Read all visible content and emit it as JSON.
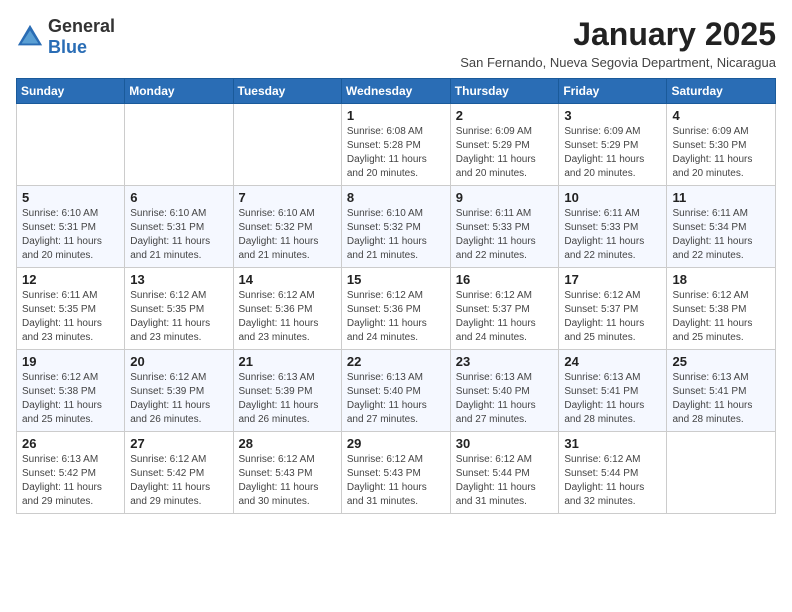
{
  "logo": {
    "general": "General",
    "blue": "Blue"
  },
  "title": "January 2025",
  "subtitle": "San Fernando, Nueva Segovia Department, Nicaragua",
  "weekdays": [
    "Sunday",
    "Monday",
    "Tuesday",
    "Wednesday",
    "Thursday",
    "Friday",
    "Saturday"
  ],
  "weeks": [
    [
      {
        "day": "",
        "info": ""
      },
      {
        "day": "",
        "info": ""
      },
      {
        "day": "",
        "info": ""
      },
      {
        "day": "1",
        "info": "Sunrise: 6:08 AM\nSunset: 5:28 PM\nDaylight: 11 hours and 20 minutes."
      },
      {
        "day": "2",
        "info": "Sunrise: 6:09 AM\nSunset: 5:29 PM\nDaylight: 11 hours and 20 minutes."
      },
      {
        "day": "3",
        "info": "Sunrise: 6:09 AM\nSunset: 5:29 PM\nDaylight: 11 hours and 20 minutes."
      },
      {
        "day": "4",
        "info": "Sunrise: 6:09 AM\nSunset: 5:30 PM\nDaylight: 11 hours and 20 minutes."
      }
    ],
    [
      {
        "day": "5",
        "info": "Sunrise: 6:10 AM\nSunset: 5:31 PM\nDaylight: 11 hours and 20 minutes."
      },
      {
        "day": "6",
        "info": "Sunrise: 6:10 AM\nSunset: 5:31 PM\nDaylight: 11 hours and 21 minutes."
      },
      {
        "day": "7",
        "info": "Sunrise: 6:10 AM\nSunset: 5:32 PM\nDaylight: 11 hours and 21 minutes."
      },
      {
        "day": "8",
        "info": "Sunrise: 6:10 AM\nSunset: 5:32 PM\nDaylight: 11 hours and 21 minutes."
      },
      {
        "day": "9",
        "info": "Sunrise: 6:11 AM\nSunset: 5:33 PM\nDaylight: 11 hours and 22 minutes."
      },
      {
        "day": "10",
        "info": "Sunrise: 6:11 AM\nSunset: 5:33 PM\nDaylight: 11 hours and 22 minutes."
      },
      {
        "day": "11",
        "info": "Sunrise: 6:11 AM\nSunset: 5:34 PM\nDaylight: 11 hours and 22 minutes."
      }
    ],
    [
      {
        "day": "12",
        "info": "Sunrise: 6:11 AM\nSunset: 5:35 PM\nDaylight: 11 hours and 23 minutes."
      },
      {
        "day": "13",
        "info": "Sunrise: 6:12 AM\nSunset: 5:35 PM\nDaylight: 11 hours and 23 minutes."
      },
      {
        "day": "14",
        "info": "Sunrise: 6:12 AM\nSunset: 5:36 PM\nDaylight: 11 hours and 23 minutes."
      },
      {
        "day": "15",
        "info": "Sunrise: 6:12 AM\nSunset: 5:36 PM\nDaylight: 11 hours and 24 minutes."
      },
      {
        "day": "16",
        "info": "Sunrise: 6:12 AM\nSunset: 5:37 PM\nDaylight: 11 hours and 24 minutes."
      },
      {
        "day": "17",
        "info": "Sunrise: 6:12 AM\nSunset: 5:37 PM\nDaylight: 11 hours and 25 minutes."
      },
      {
        "day": "18",
        "info": "Sunrise: 6:12 AM\nSunset: 5:38 PM\nDaylight: 11 hours and 25 minutes."
      }
    ],
    [
      {
        "day": "19",
        "info": "Sunrise: 6:12 AM\nSunset: 5:38 PM\nDaylight: 11 hours and 25 minutes."
      },
      {
        "day": "20",
        "info": "Sunrise: 6:12 AM\nSunset: 5:39 PM\nDaylight: 11 hours and 26 minutes."
      },
      {
        "day": "21",
        "info": "Sunrise: 6:13 AM\nSunset: 5:39 PM\nDaylight: 11 hours and 26 minutes."
      },
      {
        "day": "22",
        "info": "Sunrise: 6:13 AM\nSunset: 5:40 PM\nDaylight: 11 hours and 27 minutes."
      },
      {
        "day": "23",
        "info": "Sunrise: 6:13 AM\nSunset: 5:40 PM\nDaylight: 11 hours and 27 minutes."
      },
      {
        "day": "24",
        "info": "Sunrise: 6:13 AM\nSunset: 5:41 PM\nDaylight: 11 hours and 28 minutes."
      },
      {
        "day": "25",
        "info": "Sunrise: 6:13 AM\nSunset: 5:41 PM\nDaylight: 11 hours and 28 minutes."
      }
    ],
    [
      {
        "day": "26",
        "info": "Sunrise: 6:13 AM\nSunset: 5:42 PM\nDaylight: 11 hours and 29 minutes."
      },
      {
        "day": "27",
        "info": "Sunrise: 6:12 AM\nSunset: 5:42 PM\nDaylight: 11 hours and 29 minutes."
      },
      {
        "day": "28",
        "info": "Sunrise: 6:12 AM\nSunset: 5:43 PM\nDaylight: 11 hours and 30 minutes."
      },
      {
        "day": "29",
        "info": "Sunrise: 6:12 AM\nSunset: 5:43 PM\nDaylight: 11 hours and 31 minutes."
      },
      {
        "day": "30",
        "info": "Sunrise: 6:12 AM\nSunset: 5:44 PM\nDaylight: 11 hours and 31 minutes."
      },
      {
        "day": "31",
        "info": "Sunrise: 6:12 AM\nSunset: 5:44 PM\nDaylight: 11 hours and 32 minutes."
      },
      {
        "day": "",
        "info": ""
      }
    ]
  ]
}
